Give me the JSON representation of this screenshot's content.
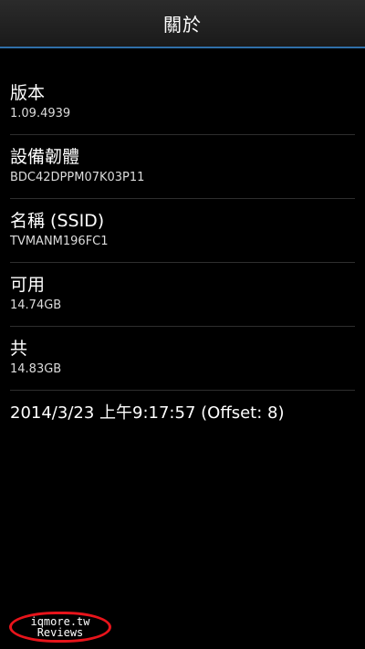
{
  "action_bar": {
    "title": "關於"
  },
  "items": [
    {
      "title": "版本",
      "value": "1.09.4939"
    },
    {
      "title": "設備韌體",
      "value": "BDC42DPPM07K03P11"
    },
    {
      "title": "名稱 (SSID)",
      "value": "TVMANM196FC1"
    },
    {
      "title": "可用",
      "value": "14.74GB"
    },
    {
      "title": "共",
      "value": "14.83GB"
    }
  ],
  "datetime": "2014/3/23 上午9:17:57 (Offset: 8)",
  "watermark": {
    "line1": "iqmore.tw",
    "line2": "Reviews"
  },
  "colors": {
    "background": "#000000",
    "accent_line": "#2f6fa8",
    "watermark_ring": "#e8141b"
  }
}
